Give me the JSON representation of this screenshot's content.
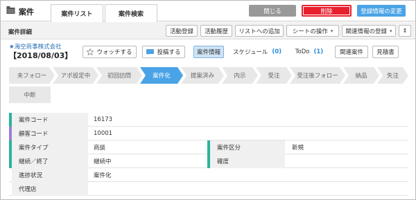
{
  "app": {
    "title": "案件",
    "icon": "folder-icon"
  },
  "tabs": [
    {
      "label": "案件リスト"
    },
    {
      "label": "案件検索"
    }
  ],
  "top_buttons": {
    "close": "閉じる",
    "delete": "削除",
    "edit": "登録情報の変更"
  },
  "colors": {
    "accent": "#4aa3e6",
    "danger": "#e8202e",
    "gray_button": "#999999",
    "bar_teal": "#2bb39a",
    "bar_purple": "#9a7fd6"
  },
  "subheader": {
    "title": "案件詳細",
    "buttons": [
      {
        "label": "活動登録"
      },
      {
        "label": "活動履歴"
      },
      {
        "label": "リストへの追加"
      },
      {
        "label": "シートの操作",
        "chevron": "▾"
      },
      {
        "label": "関連情報の登録",
        "chevron": "▾"
      }
    ],
    "expand_icon": "⇕"
  },
  "record": {
    "customer": "★海空商事株式会社",
    "date_label": "【2018/08/03】",
    "watch_label": "ウォッチする",
    "post_label": "投稿する"
  },
  "panel_tabs": {
    "info": "案件情報",
    "schedule": "スケジュール",
    "schedule_count": "(0)",
    "todo": "ToDo",
    "todo_count": "(1)",
    "related": "関連案件",
    "estimate": "見積書"
  },
  "steps": [
    {
      "label": "未フォロー"
    },
    {
      "label": "アポ設定中"
    },
    {
      "label": "初回訪問"
    },
    {
      "label": "案件化",
      "active": true
    },
    {
      "label": "提案済み"
    },
    {
      "label": "内示"
    },
    {
      "label": "受注"
    },
    {
      "label": "受注後フォロー"
    },
    {
      "label": "納品"
    },
    {
      "label": "失注"
    }
  ],
  "step_extra": "中断",
  "details": {
    "case_code_label": "案件コード",
    "case_code": "16173",
    "customer_code_label": "顧客コード",
    "customer_code": "10001",
    "case_type_label": "案件タイプ",
    "case_type": "商談",
    "case_class_label": "案件区分",
    "case_class": "新規",
    "continue_label": "継続／終了",
    "continue_value": "継続中",
    "certainty_label": "確度",
    "certainty": "",
    "progress_label": "進捗状況",
    "progress": "案件化",
    "agency_label": "代理店",
    "agency": ""
  }
}
